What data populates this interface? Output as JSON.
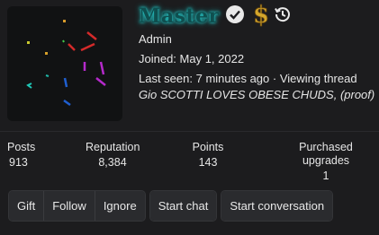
{
  "profile": {
    "username": "Master",
    "title": "Admin",
    "joined": "Joined: May 1, 2022",
    "last_seen_prefix": "Last seen: 7 minutes ago · Viewing thread ",
    "last_seen_thread": "Gio SCOTTI LOVES OBESE CHUDS, (proof)",
    "badges": [
      "verified-check-icon",
      "dollar-sign-icon",
      "history-icon"
    ]
  },
  "stats": [
    {
      "label": "Posts",
      "value": "913"
    },
    {
      "label": "Reputation",
      "value": "8,384"
    },
    {
      "label": "Points",
      "value": "143"
    },
    {
      "label": "Purchased upgrades",
      "value": "1"
    }
  ],
  "actions": {
    "gift": "Gift",
    "follow": "Follow",
    "ignore": "Ignore",
    "start_chat": "Start chat",
    "start_conversation": "Start conversation"
  },
  "colors": {
    "background": "#1c1c1e",
    "username_glow": "#26d9d9",
    "dollar_gold": "#d4a72c",
    "button_bg": "#2a2b2e"
  }
}
